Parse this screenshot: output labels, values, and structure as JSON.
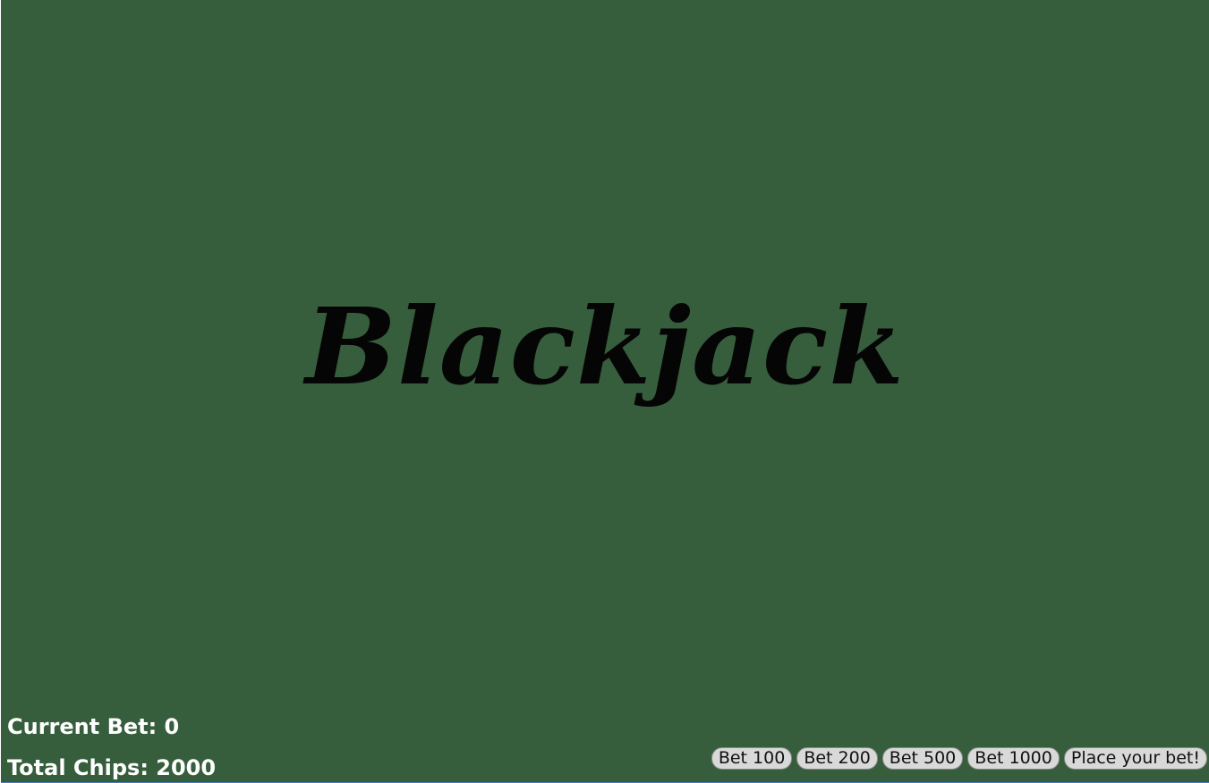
{
  "game": {
    "title": "Blackjack"
  },
  "stats": {
    "current_bet": "Current Bet: 0",
    "total_chips": "Total Chips: 2000"
  },
  "controls": {
    "bet_100": "Bet 100",
    "bet_200": "Bet 200",
    "bet_500": "Bet 500",
    "bet_1000": "Bet 1000",
    "place_bet": "Place your bet!"
  },
  "colors": {
    "felt": "#365e3c",
    "title": "#050505",
    "text": "#ffffff",
    "button": "#d9d9d9"
  }
}
